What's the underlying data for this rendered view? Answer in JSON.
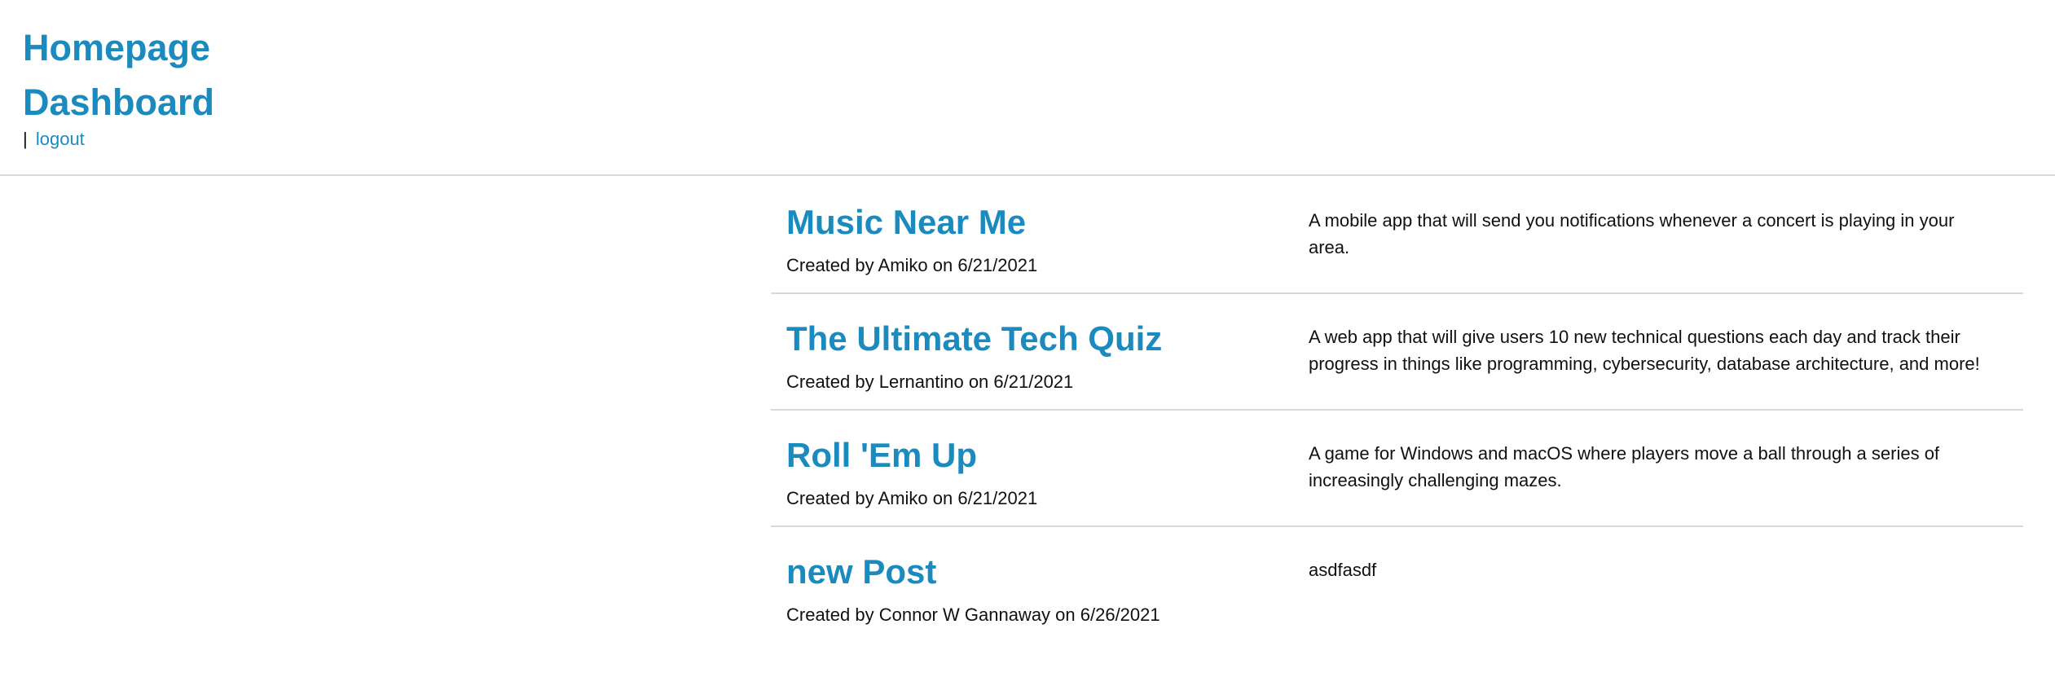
{
  "header": {
    "home_label": "Homepage",
    "dashboard_label": "Dashboard",
    "separator": "|",
    "logout_label": "logout"
  },
  "posts": [
    {
      "title": "Music Near Me",
      "meta": "Created by Amiko on 6/21/2021",
      "description": "A mobile app that will send you notifications whenever a concert is playing in your area."
    },
    {
      "title": "The Ultimate Tech Quiz",
      "meta": "Created by Lernantino on 6/21/2021",
      "description": "A web app that will give users 10 new technical questions each day and track their progress in things like programming, cybersecurity, database architecture, and more!"
    },
    {
      "title": "Roll 'Em Up",
      "meta": "Created by Amiko on 6/21/2021",
      "description": "A game for Windows and macOS where players move a ball through a series of increasingly challenging mazes."
    },
    {
      "title": "new Post",
      "meta": "Created by Connor W Gannaway on 6/26/2021",
      "description": "asdfasdf"
    }
  ],
  "colors": {
    "link": "#1b8bbf",
    "divider": "#d9d9d9",
    "text": "#111111"
  }
}
